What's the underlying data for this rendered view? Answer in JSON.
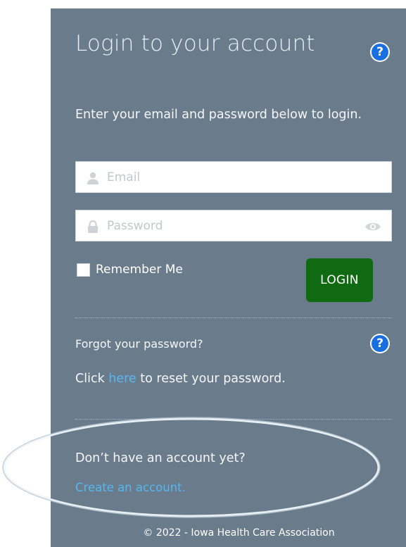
{
  "login": {
    "title": "Login to your account",
    "intro": "Enter your email and password below to login.",
    "email_placeholder": "Email",
    "password_placeholder": "Password",
    "remember_label": "Remember Me",
    "remember_checked": false,
    "login_button": "LOGIN"
  },
  "forgot": {
    "title": "Forgot your password?",
    "prefix": "Click ",
    "link": "here",
    "suffix": " to reset your password."
  },
  "signup": {
    "question": "Don’t have an account yet?",
    "link": "Create an account."
  },
  "footer": {
    "text": "© 2022 - Iowa Health Care Association"
  },
  "icons": {
    "help": "help-circle-icon",
    "user": "user-icon",
    "lock": "lock-icon",
    "show_password": "eye-icon"
  },
  "colors": {
    "panel_bg": "#6a7b8c",
    "login_button": "#0f6a12",
    "link": "#56b8f0",
    "help_icon": "#1a6fe0"
  }
}
